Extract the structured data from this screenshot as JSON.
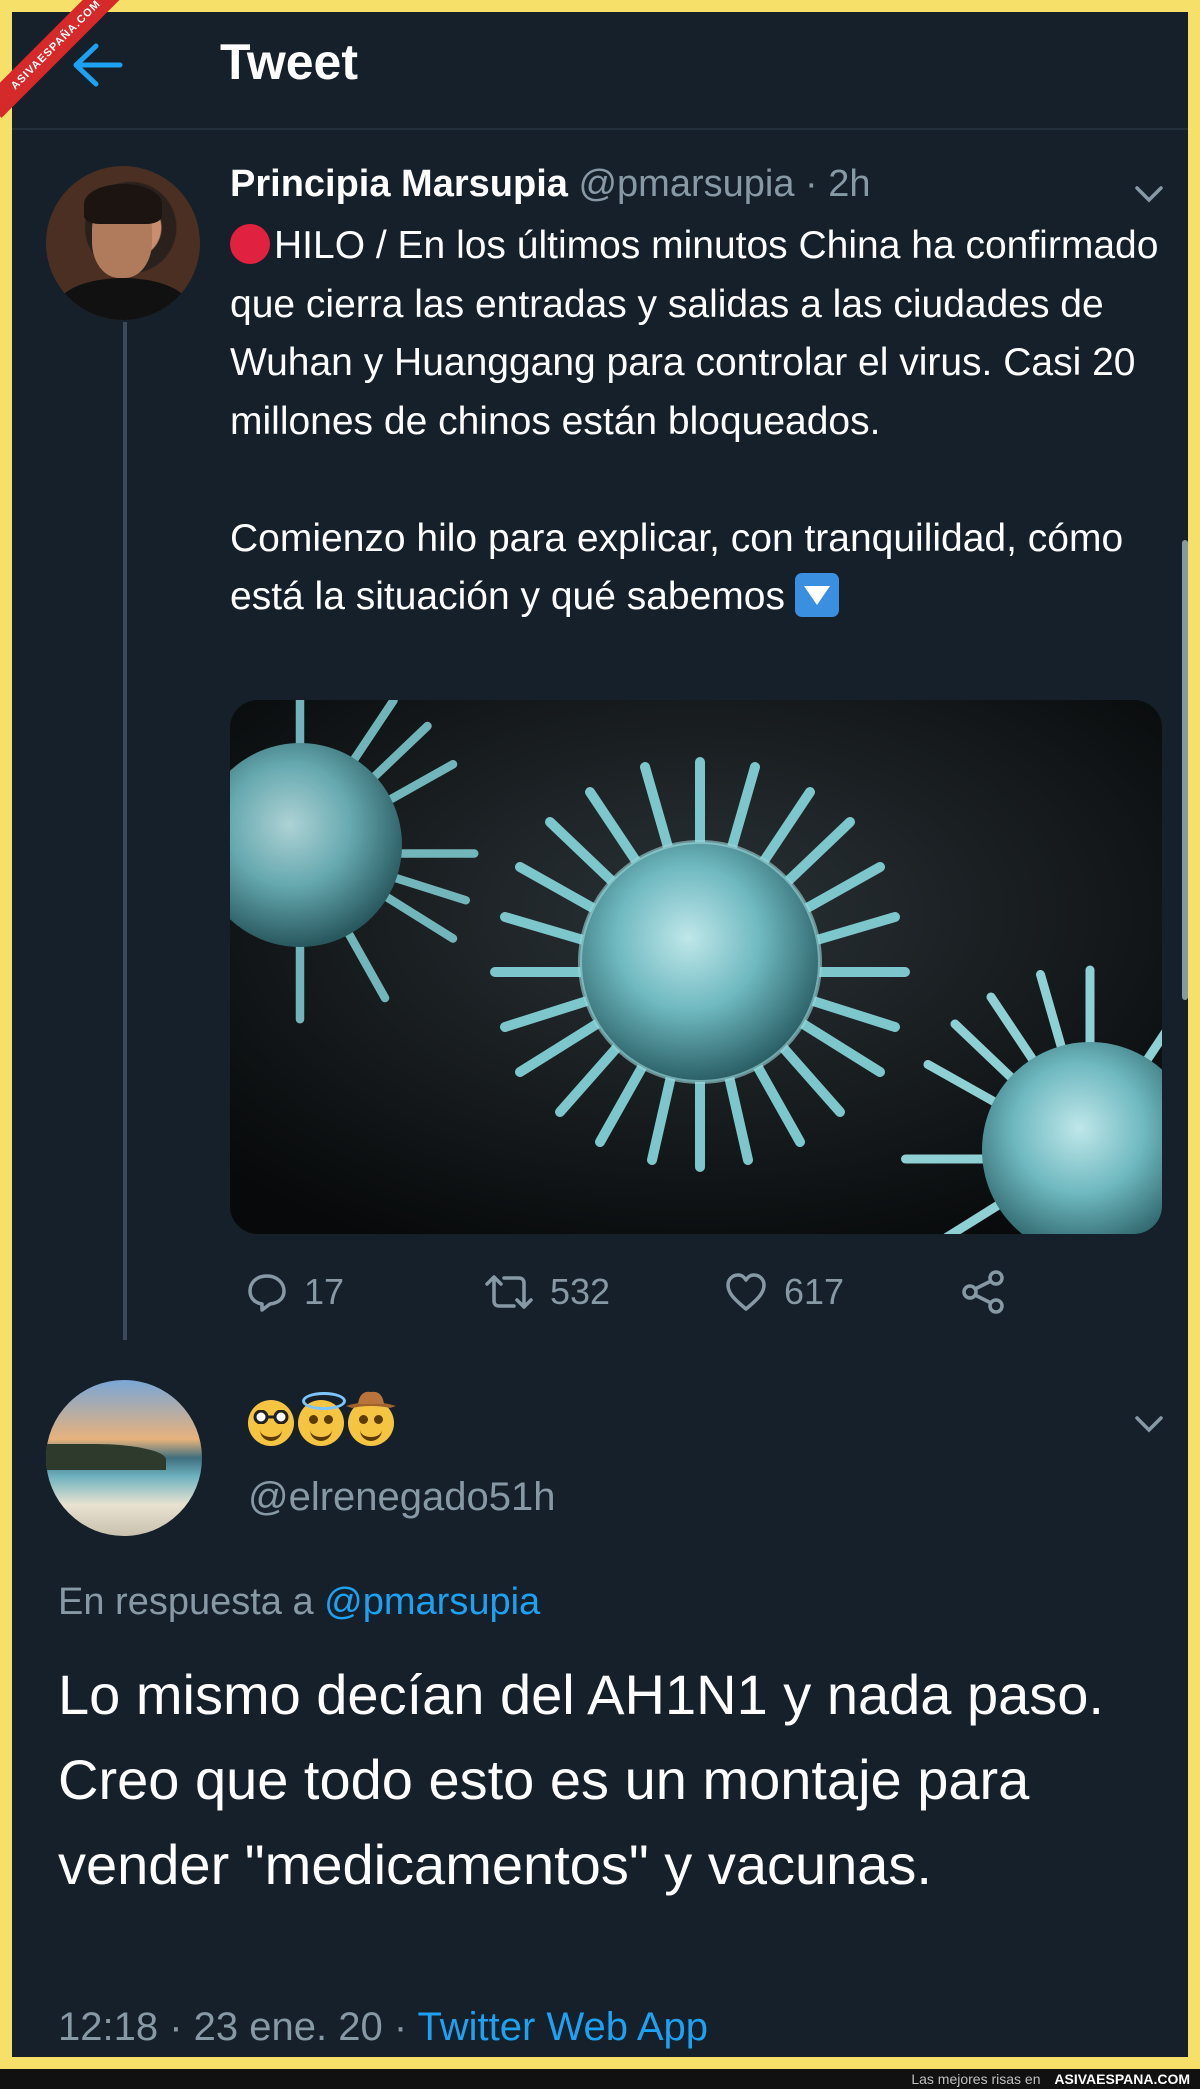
{
  "header": {
    "title": "Tweet"
  },
  "watermark": {
    "badge": "ASIVAESPAÑA.COM"
  },
  "tweet": {
    "author_name": "Principia Marsupia",
    "author_handle": "@pmarsupia",
    "time": "· 2h",
    "text": "HILO / En los últimos minutos China ha confirmado que cierra las entradas y salidas a las ciudades de Wuhan y Huanggang para controlar el virus. Casi 20 millones de chinos están bloqueados.\n\nComienzo hilo para explicar, con tranquilidad, cómo está la situación y qué sabemos",
    "media_icon": "virus-illustration",
    "actions": {
      "replies": "17",
      "retweets": "532",
      "likes": "617"
    }
  },
  "reply": {
    "display_name_emoji": [
      "nerd-face-emoji",
      "halo-face-emoji",
      "cowboy-face-emoji"
    ],
    "handle": "@elrenegado51h",
    "in_reply_prefix": "En respuesta a",
    "in_reply_handle": "@pmarsupia",
    "text": "Lo mismo decían del AH1N1 y nada paso. Creo que todo esto es un montaje para vender \"medicamentos\" y vacunas.",
    "timestamp": "12:18 · 23 ene. 20 ·",
    "source": "Twitter Web App"
  },
  "footer": {
    "prefix": "Las mejores risas en",
    "site": "ASIVAESPANA.COM"
  },
  "colors": {
    "background": "#15202b",
    "accent": "#1da1f2",
    "muted": "#8899a6",
    "frame": "#f6e06a"
  }
}
